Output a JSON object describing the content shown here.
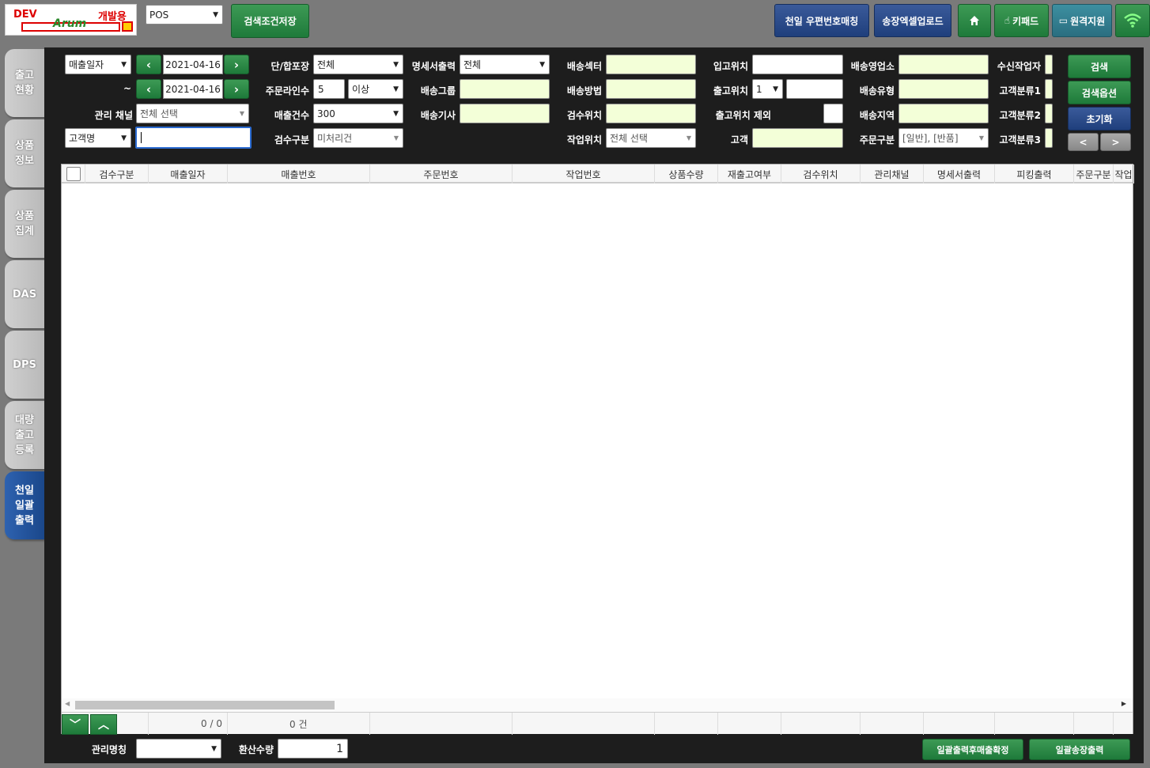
{
  "header": {
    "logo_dev": "DEV",
    "logo_kor": "개발용",
    "logo_mark": "Arum",
    "pos_select": "POS",
    "save_search_label": "검색조건저장",
    "zip_match_label": "천일 우편번호매칭",
    "excel_upload_label": "송장엑셀업로드",
    "keypad_label": "키패드",
    "remote_label": "원격지원"
  },
  "sidebar": {
    "tabs": [
      {
        "label": "출고\n현황"
      },
      {
        "label": "상품\n정보"
      },
      {
        "label": "상품\n집계"
      },
      {
        "label": "DAS"
      },
      {
        "label": "DPS"
      },
      {
        "label": "대량\n출고\n등록"
      },
      {
        "label": "천일\n일괄\n출력"
      }
    ]
  },
  "search": {
    "date_type": "매출일자",
    "date_from": "2021-04-16",
    "tilde": "~",
    "date_to": "2021-04-16",
    "channel_label": "관리 채널",
    "channel_value": "전체 선택",
    "customer_type": "고객명",
    "customer_value": "",
    "pack_label": "단/합포장",
    "pack_value": "전체",
    "order_lines_label": "주문라인수",
    "order_lines_value": "5",
    "order_lines_cond": "이상",
    "sales_count_label": "매출건수",
    "sales_count_value": "300",
    "inspect_type_label": "검수구분",
    "inspect_type_value": "미처리건",
    "statement_label": "명세서출력",
    "statement_value": "전체",
    "delivery_group_label": "배송그룹",
    "delivery_driver_label": "배송기사",
    "delivery_sector_label": "배송섹터",
    "delivery_method_label": "배송방법",
    "inspect_loc_label": "검수위치",
    "work_loc_label": "작업위치",
    "work_loc_value": "전체 선택",
    "inbound_loc_label": "입고위치",
    "outbound_loc_label": "출고위치",
    "outbound_loc_value": "1",
    "outbound_exclude_label": "출고위치 제외",
    "customer_label": "고객",
    "delivery_office_label": "배송영업소",
    "delivery_type_label": "배송유형",
    "delivery_region_label": "배송지역",
    "order_type_label": "주문구분",
    "order_type_value": "[일반], [반품]",
    "receive_worker_label": "수신작업자",
    "cust_class1_label": "고객분류1",
    "cust_class2_label": "고객분류2",
    "cust_class3_label": "고객분류3",
    "search_btn": "검색",
    "search_opt_btn": "검색옵션",
    "reset_btn": "초기화",
    "prev_btn": "<",
    "next_btn": ">"
  },
  "grid": {
    "columns": [
      "검수구분",
      "매출일자",
      "매출번호",
      "주문번호",
      "작업번호",
      "상품수량",
      "재출고여부",
      "검수위치",
      "관리채널",
      "명세서출력",
      "피킹출력",
      "주문구분",
      "작업"
    ],
    "footer_count": "0 / 0",
    "footer_total": "0 건"
  },
  "bottom": {
    "mgmt_name_label": "관리명칭",
    "convert_qty_label": "환산수량",
    "convert_qty_value": "1",
    "confirm_btn": "일괄출력후매출확정",
    "print_btn": "일괄송장출력"
  }
}
